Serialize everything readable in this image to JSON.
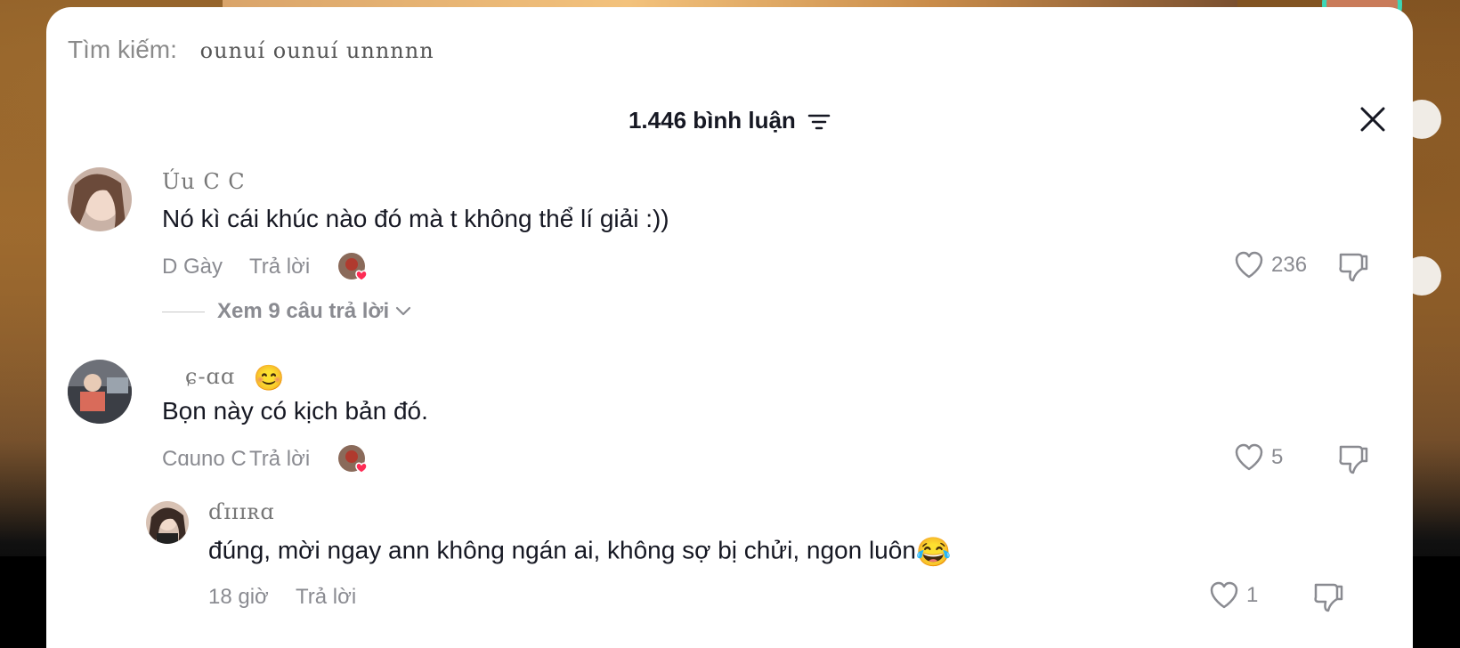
{
  "search": {
    "label": "Tìm kiếm:",
    "query": "ounuí ounuí unnnnn"
  },
  "header": {
    "title": "1.446 bình luận"
  },
  "comments": [
    {
      "username": "Úu  C  C",
      "text": "Nó kì cái khúc nào đó mà t không thể lí giải :))",
      "time": "D Gày",
      "reply_label": "Trả lời",
      "likes": "236",
      "view_replies": "Xem 9 câu trả lời"
    },
    {
      "username": "ɕ-ɑɑ",
      "username_emoji": "😊",
      "text": "Bọn này có kịch bản đó.",
      "time": "Cɑuno C",
      "reply_label": "Trả lời",
      "likes": "5"
    }
  ],
  "reply": {
    "username": "ɗɪɪɪʀɑ",
    "text": "đúng, mời ngay ann không ngán ai, không sợ bị chửi, ngon luôn",
    "text_emoji": "😂",
    "time": "18 giờ",
    "reply_label": "Trả lời",
    "likes": "1"
  },
  "colors": {
    "heart_badge": "#fe2c55",
    "text_primary": "#161823",
    "text_secondary": "#8a8b91",
    "accent_ring": "#3dd6b6"
  },
  "icons": {
    "sort": "sort-icon",
    "close": "close-icon",
    "like": "heart-outline-icon",
    "dislike": "thumbs-down-icon",
    "expand": "chevron-down-icon"
  }
}
